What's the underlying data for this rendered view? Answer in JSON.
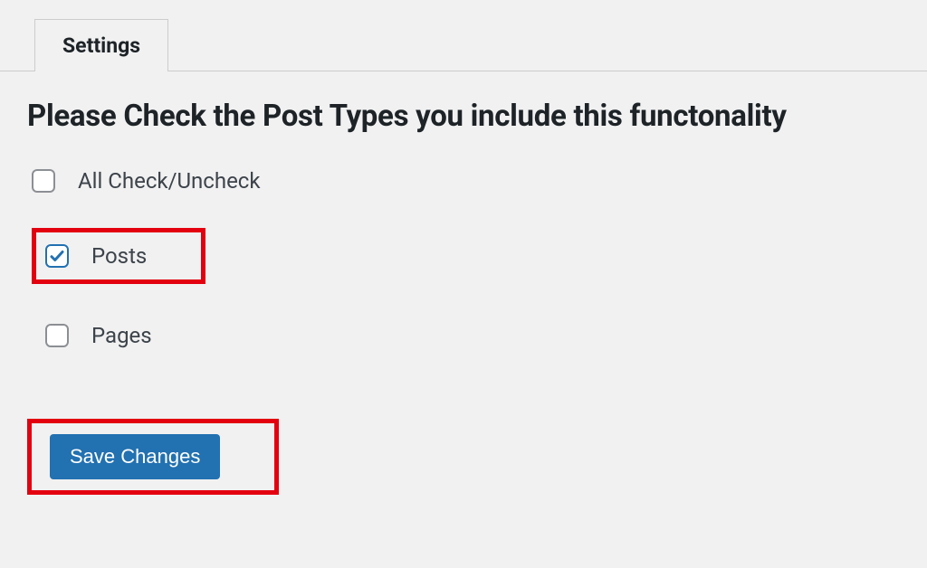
{
  "tab": {
    "label": "Settings"
  },
  "heading": "Please Check the Post Types you include this functonality",
  "checkboxes": {
    "all": {
      "label": "All Check/Uncheck",
      "checked": false
    },
    "posts": {
      "label": "Posts",
      "checked": true
    },
    "pages": {
      "label": "Pages",
      "checked": false
    }
  },
  "button": {
    "save_label": "Save Changes"
  },
  "colors": {
    "highlight": "#e3000f",
    "primary": "#2271b1"
  }
}
